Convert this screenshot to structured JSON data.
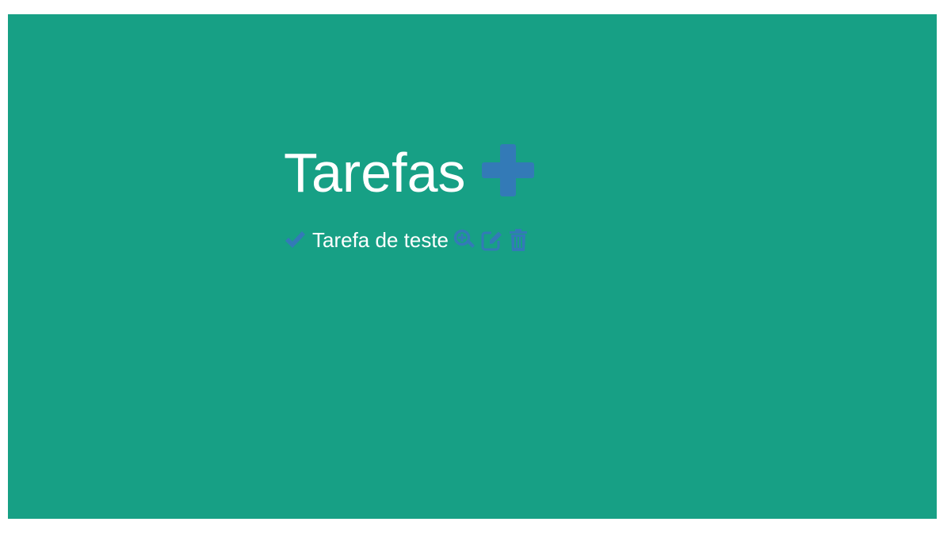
{
  "page": {
    "title": "Tarefas",
    "colors": {
      "background": "#17a085",
      "accent": "#337ab7",
      "text": "#ffffff"
    }
  },
  "header": {
    "add_icon": "plus-icon"
  },
  "tasks": [
    {
      "label": "Tarefa de teste",
      "status_icon": "check-icon",
      "actions": [
        "zoom-in-icon",
        "edit-icon",
        "trash-icon"
      ]
    }
  ]
}
